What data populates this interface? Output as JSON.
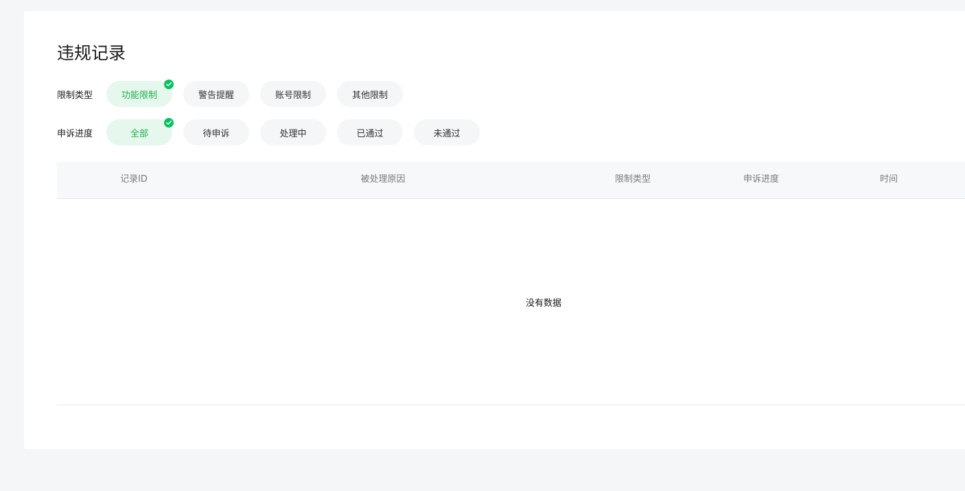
{
  "page": {
    "title": "违规记录"
  },
  "filters": {
    "restriction_type": {
      "label": "限制类型",
      "options": [
        "功能限制",
        "警告提醒",
        "账号限制",
        "其他限制"
      ],
      "selected": "功能限制"
    },
    "appeal_progress": {
      "label": "申诉进度",
      "options": [
        "全部",
        "待申诉",
        "处理中",
        "已通过",
        "未通过"
      ],
      "selected": "全部"
    }
  },
  "table": {
    "columns": [
      "记录ID",
      "被处理原因",
      "限制类型",
      "申诉进度",
      "时间"
    ],
    "rows": [],
    "empty_text": "没有数据"
  },
  "colors": {
    "accent": "#07c160",
    "selected_bg": "#e6f7ed",
    "selected_text": "#22b14c"
  },
  "icons": {
    "selected_marker": "check-circle-icon"
  }
}
